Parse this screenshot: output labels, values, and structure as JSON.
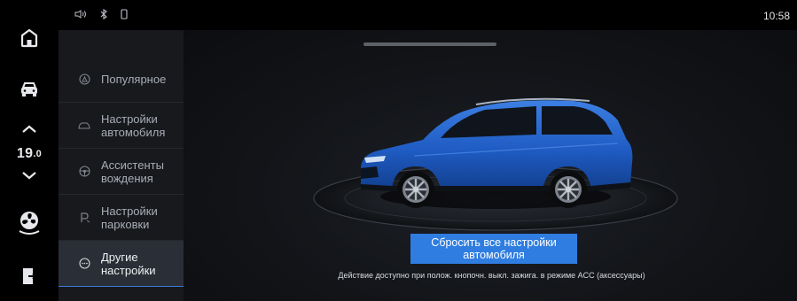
{
  "status_bar": {
    "icons": [
      "volume-icon",
      "bluetooth-icon",
      "phone-icon"
    ],
    "time": "10:58"
  },
  "rail": {
    "temperature": "19",
    "temperature_decimal": ".0",
    "icons": [
      "home-icon",
      "car-icon",
      "chevron-up-icon",
      "chevron-down-icon",
      "fan-icon",
      "exit-icon"
    ]
  },
  "menu": {
    "items": [
      {
        "label": "Популярное",
        "icon": "popular-icon",
        "selected": false
      },
      {
        "label_line1": "Настройки",
        "label_line2": "автомобиля",
        "icon": "car-outline-icon",
        "selected": false
      },
      {
        "label_line1": "Ассистенты",
        "label_line2": "вождения",
        "icon": "steering-wheel-icon",
        "selected": false
      },
      {
        "label_line1": "Настройки",
        "label_line2": "парковки",
        "icon": "parking-icon",
        "selected": false
      },
      {
        "label_line1": "Другие",
        "label_line2": "настройки",
        "icon": "more-icon",
        "selected": true
      }
    ]
  },
  "main": {
    "reset_button_line1": "Сбросить все настройки",
    "reset_button_line2": "автомобиля",
    "note": "Действие доступно при полож. кнопочн. выкл. зажига. в режиме ACC (аксессуары)"
  },
  "colors": {
    "accent": "#2f7de0",
    "car_body": "#1f5cc4",
    "background": "#0a0b0d"
  }
}
